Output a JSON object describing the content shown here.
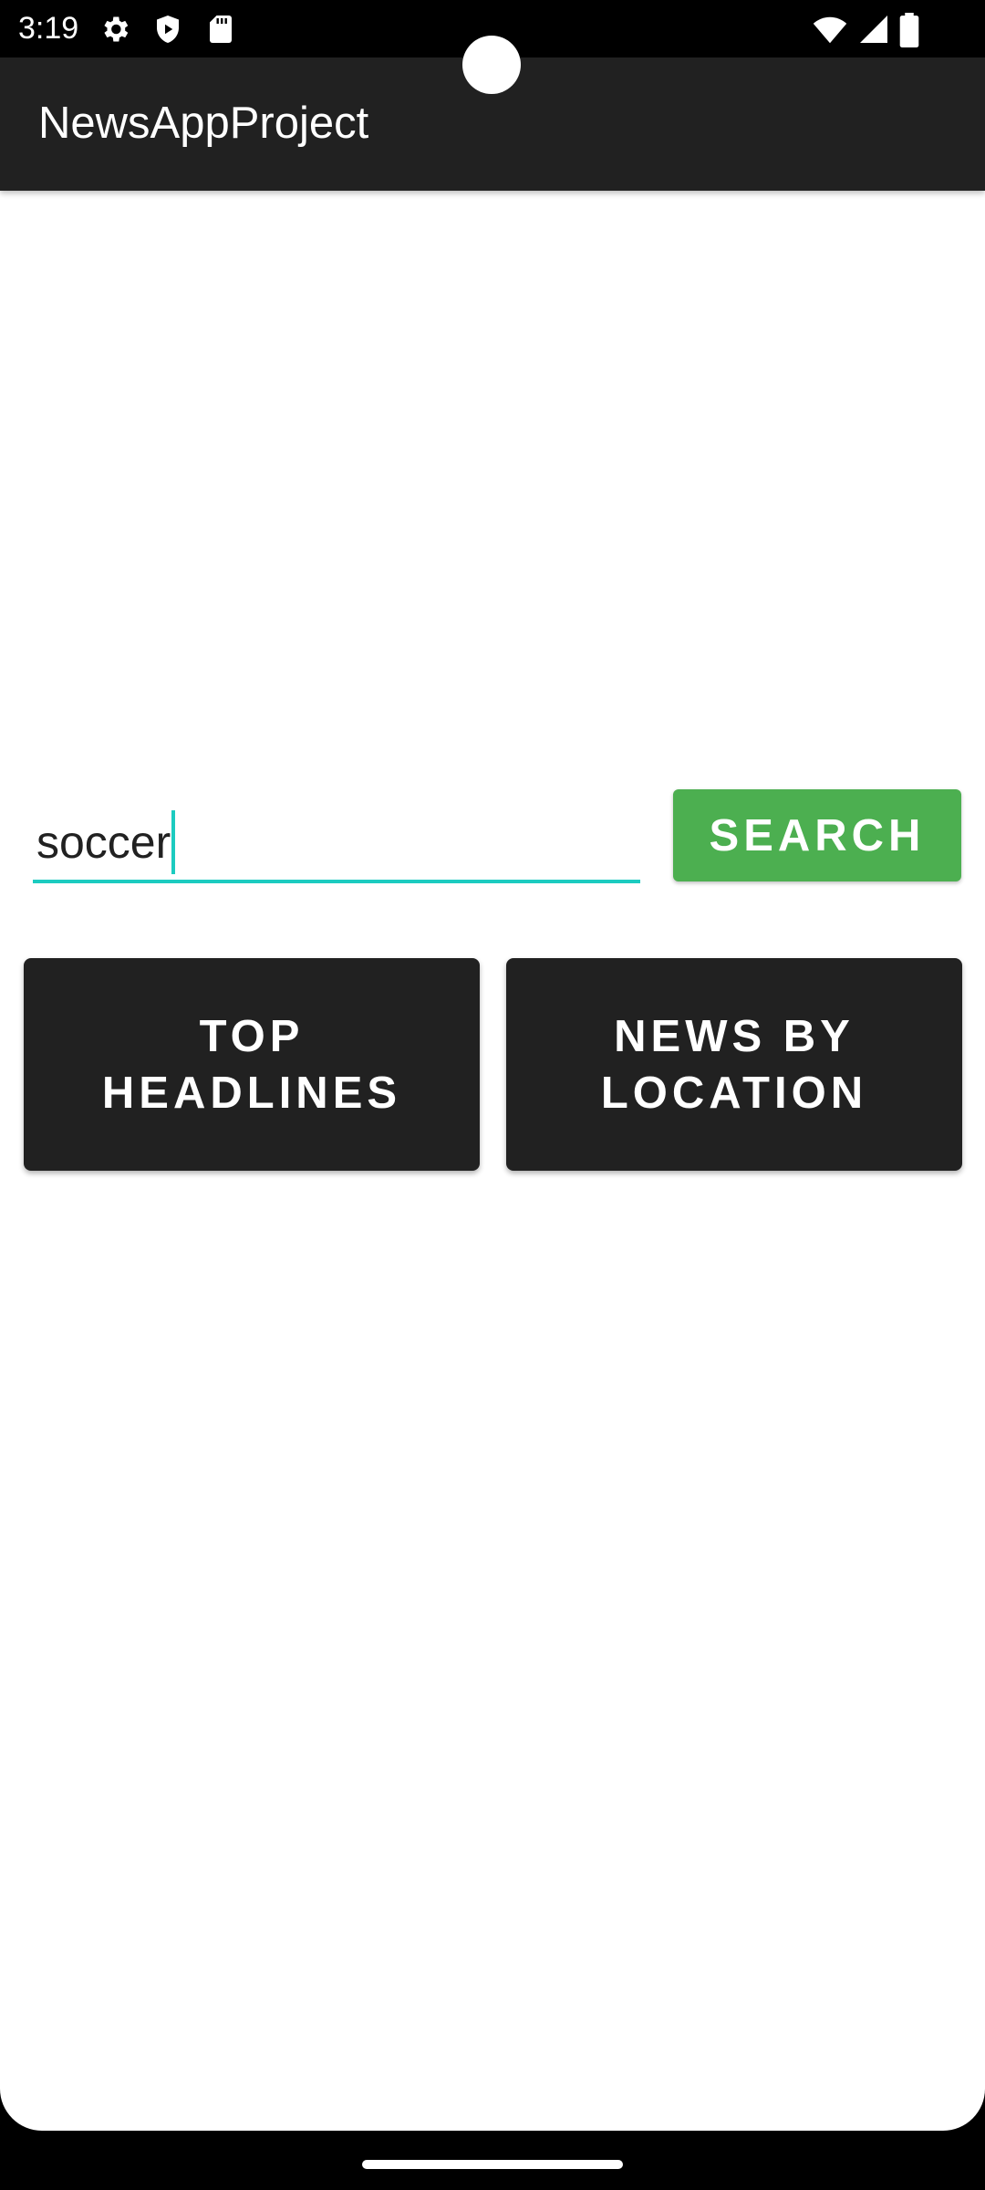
{
  "status_bar": {
    "time": "3:19",
    "left_icons": [
      "gear-icon",
      "shield-play-icon",
      "sd-card-icon"
    ],
    "right_icons": [
      "wifi-icon",
      "signal-icon",
      "battery-icon"
    ]
  },
  "app_bar": {
    "title": "NewsAppProject",
    "background_color": "#212121"
  },
  "search": {
    "value": "soccer",
    "underline_color": "#1ccbc0",
    "button_label": "SEARCH",
    "button_color": "#4caf50"
  },
  "actions": {
    "top_headlines_line1": "TOP",
    "top_headlines_line2": "HEADLINES",
    "news_by_location_line1": "NEWS BY",
    "news_by_location_line2": "LOCATION",
    "button_color": "#212121"
  }
}
